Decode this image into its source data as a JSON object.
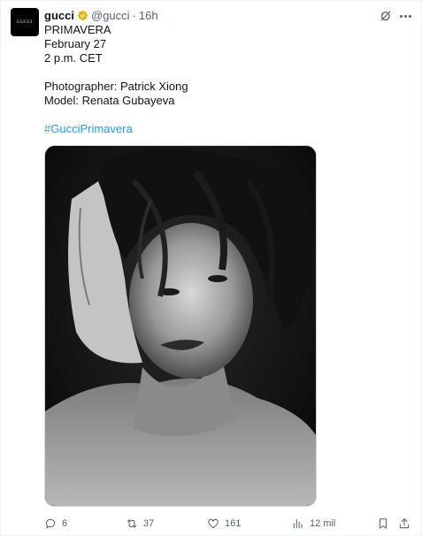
{
  "author": {
    "avatar_text": "GUCCI",
    "name": "gucci",
    "handle": "@gucci",
    "separator": "·",
    "time": "16h",
    "verified_icon": "verified-badge-gold-icon"
  },
  "tweet": {
    "lines": [
      "PRIMAVERA",
      "February 27",
      "2 p.m. CET"
    ],
    "credits": [
      "Photographer: Patrick Xiong",
      "Model: Renata Gubayeva"
    ],
    "hashtag": "#GucciPrimavera"
  },
  "media": {
    "kind": "black-and-white portrait photo"
  },
  "actions": {
    "replies": "6",
    "reposts": "37",
    "likes": "161",
    "views": "12 mil"
  },
  "colors": {
    "accent": "#1d9bf0",
    "muted": "#536471",
    "text": "#0f1419",
    "verified": "#e2b719"
  }
}
